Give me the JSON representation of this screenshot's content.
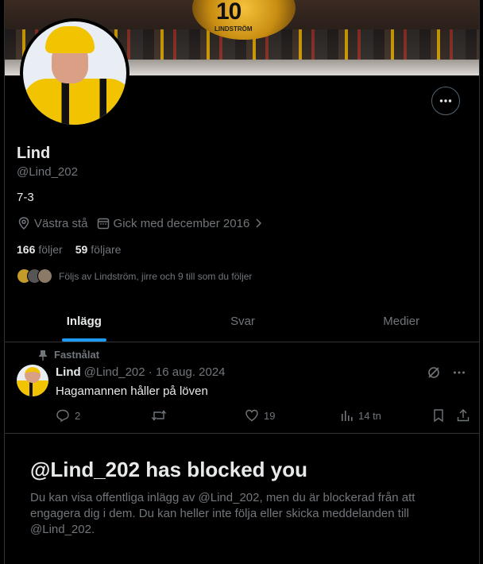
{
  "banner": {
    "number": "10",
    "flag_text": "LINDSTRÖM"
  },
  "profile": {
    "name": "Lind",
    "handle": "@Lind_202",
    "bio": "7-3",
    "location": "Västra stå",
    "joined": "Gick med december 2016",
    "following_count": "166",
    "following_label": "följer",
    "followers_count": "59",
    "followers_label": "följare",
    "followed_by": "Följs av Lindström, jirre och 9 till som du följer"
  },
  "tabs": [
    {
      "label": "Inlägg",
      "active": true
    },
    {
      "label": "Svar",
      "active": false
    },
    {
      "label": "Medier",
      "active": false
    }
  ],
  "post": {
    "pinned_label": "Fastnålat",
    "author": "Lind",
    "handle_date": "@Lind_202 · 16 aug. 2024",
    "text": "Hagamannen håller på löven",
    "replies": "2",
    "likes": "19",
    "views": "14 tn"
  },
  "blocked": {
    "title": "@Lind_202 has blocked you",
    "body": "Du kan visa offentliga inlägg av @Lind_202, men du är blockerad från att engagera dig i dem. Du kan heller inte följa eller skicka meddelanden till @Lind_202."
  },
  "colors": {
    "accent": "#1d9bf0",
    "muted": "#71767b",
    "text": "#e7e9ea",
    "border": "#2f3336"
  },
  "icons": [
    "more-icon",
    "location-icon",
    "calendar-icon",
    "chevron-right-icon",
    "pin-icon",
    "grok-icon",
    "reply-icon",
    "repost-icon",
    "like-icon",
    "views-icon",
    "bookmark-icon",
    "share-icon"
  ]
}
